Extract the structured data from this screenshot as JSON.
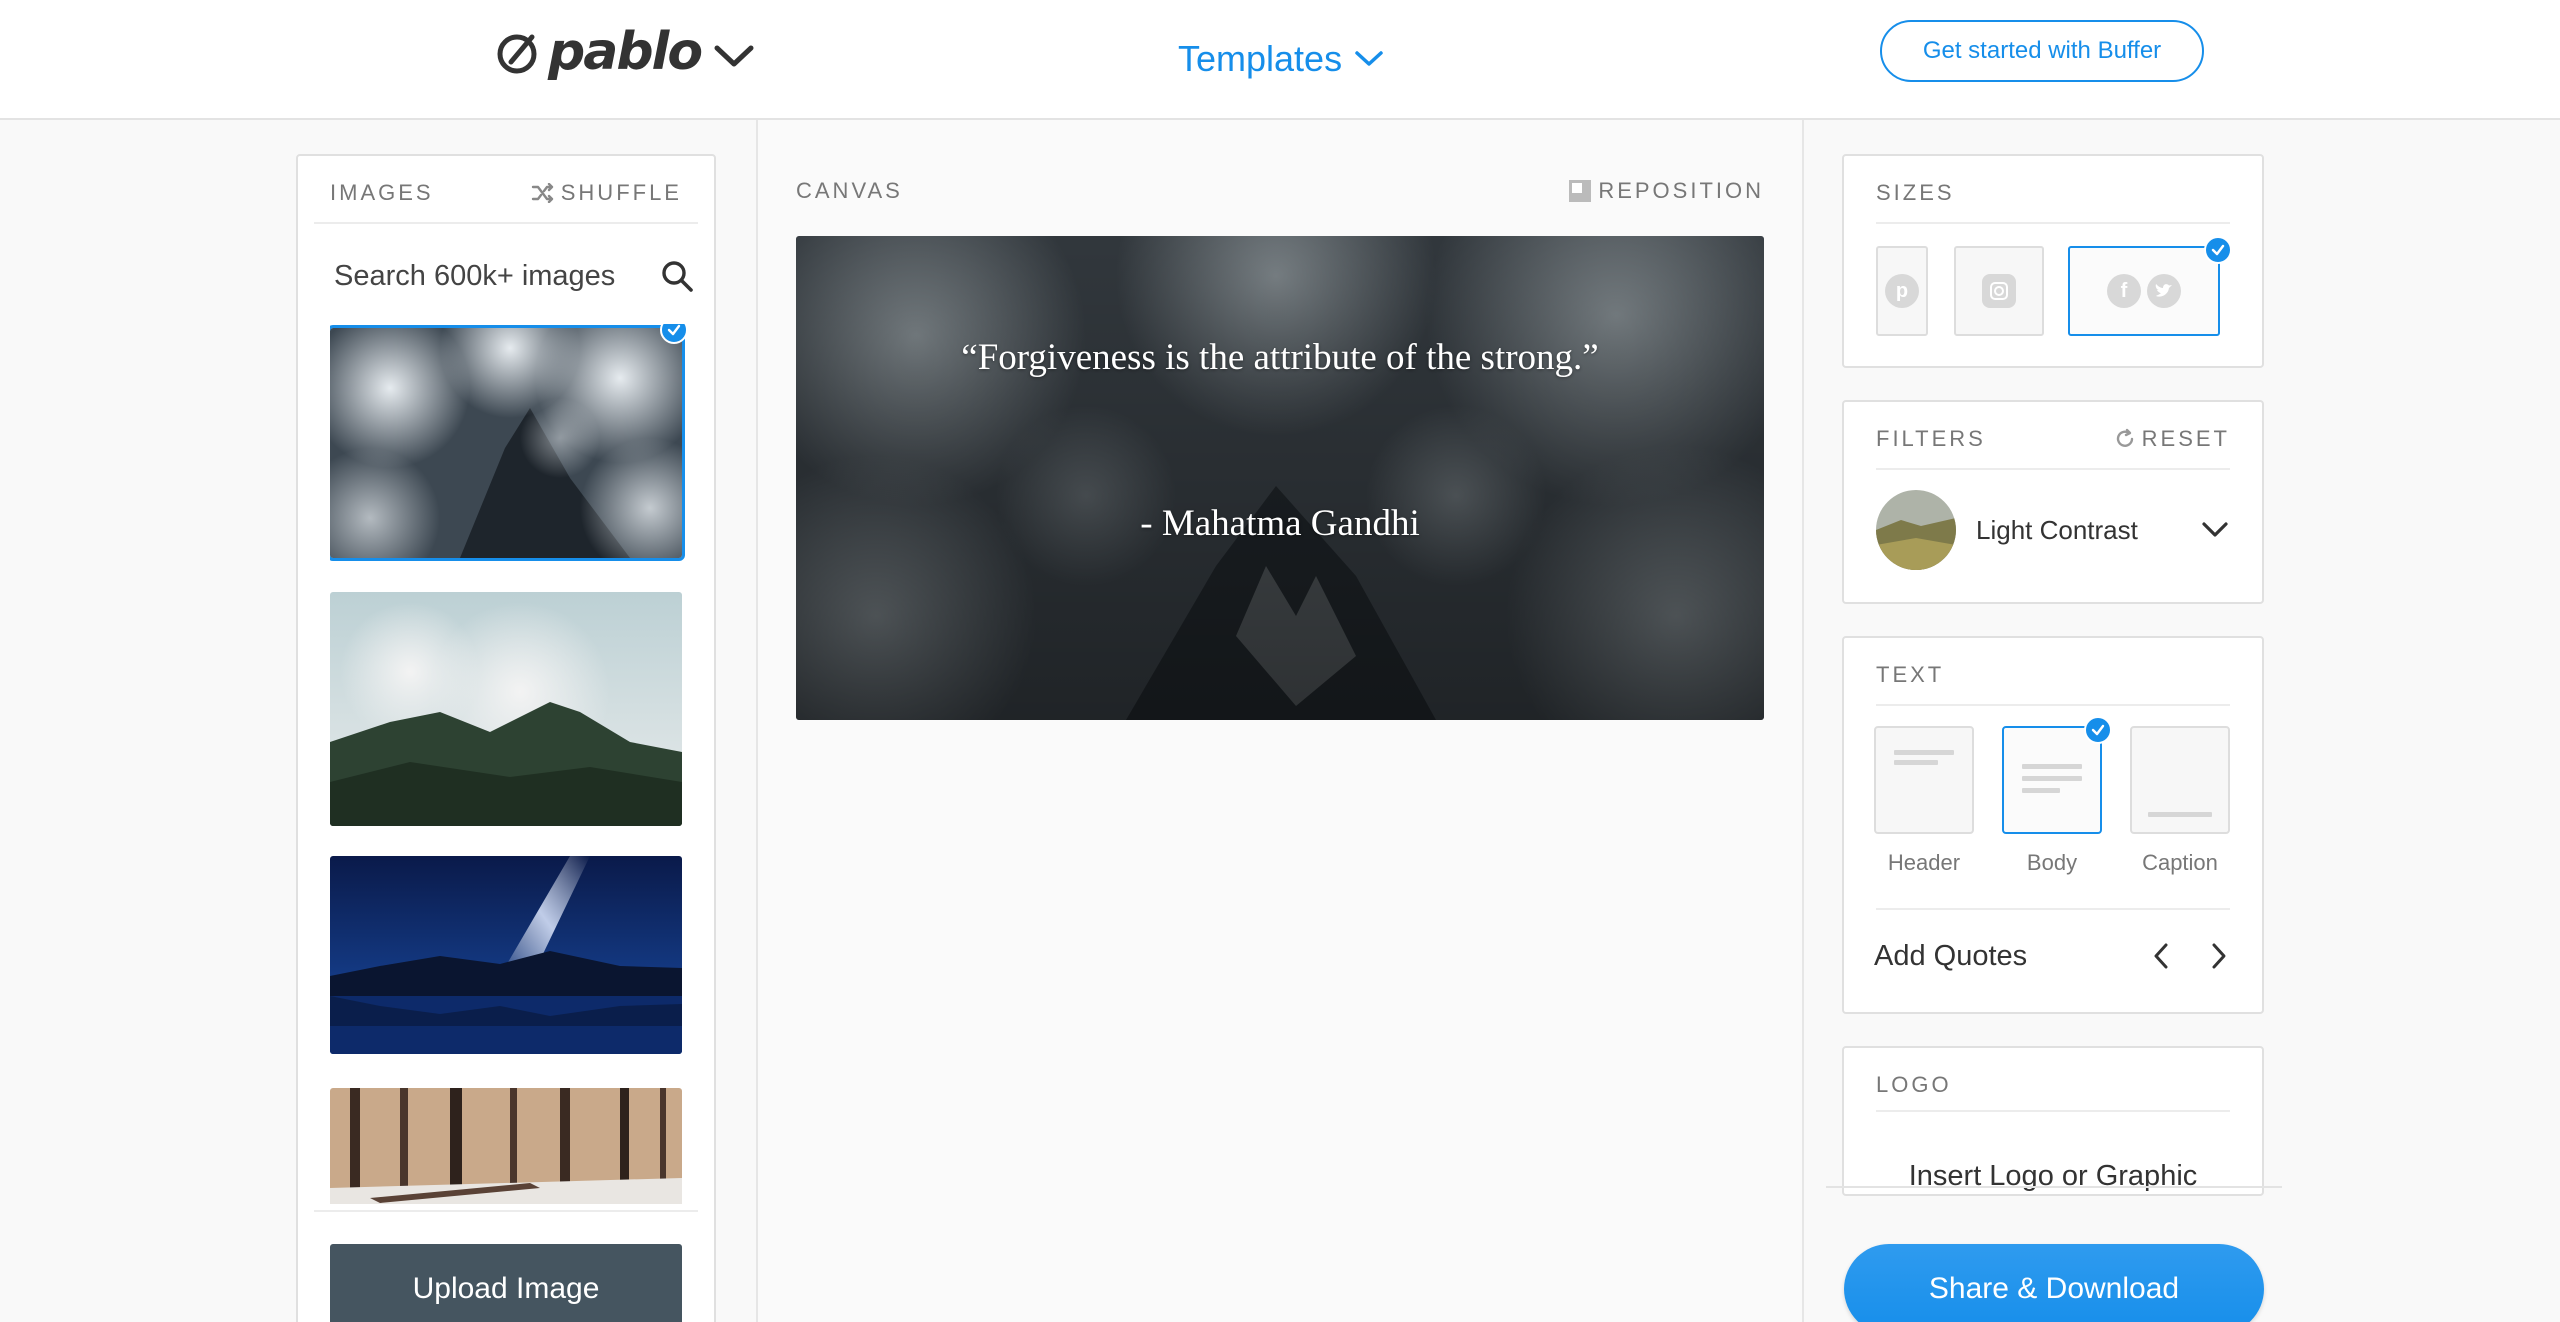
{
  "header": {
    "logo_text": "pablo",
    "templates_label": "Templates",
    "cta_label": "Get started with Buffer",
    "accent_color": "#168eea"
  },
  "images_panel": {
    "title": "IMAGES",
    "shuffle_label": "SHUFFLE",
    "search_placeholder": "Search 600k+ images",
    "thumbnails": [
      {
        "name": "clouds-mountain-aerial",
        "selected": true
      },
      {
        "name": "misty-green-mountain",
        "selected": false
      },
      {
        "name": "milky-way-lake",
        "selected": false
      },
      {
        "name": "winter-forest",
        "selected": false
      }
    ],
    "upload_label": "Upload Image"
  },
  "canvas": {
    "title": "CANVAS",
    "reposition_label": "REPOSITION",
    "quote": "“Forgiveness is the attribute of the strong.”",
    "author": "- Mahatma Gandhi"
  },
  "sizes_panel": {
    "title": "SIZES",
    "options": [
      {
        "name": "pinterest",
        "icons": [
          "pinterest-icon"
        ],
        "selected": false
      },
      {
        "name": "instagram",
        "icons": [
          "instagram-icon"
        ],
        "selected": false
      },
      {
        "name": "facebook-twitter",
        "icons": [
          "facebook-icon",
          "twitter-icon"
        ],
        "selected": true
      }
    ]
  },
  "filters_panel": {
    "title": "FILTERS",
    "reset_label": "RESET",
    "selected_filter": "Light Contrast"
  },
  "text_panel": {
    "title": "TEXT",
    "options": [
      {
        "label": "Header",
        "selected": false
      },
      {
        "label": "Body",
        "selected": true
      },
      {
        "label": "Caption",
        "selected": false
      }
    ],
    "add_quotes_label": "Add Quotes"
  },
  "logo_panel": {
    "title": "LOGO",
    "insert_label": "Insert Logo or Graphic"
  },
  "share_label": "Share & Download"
}
